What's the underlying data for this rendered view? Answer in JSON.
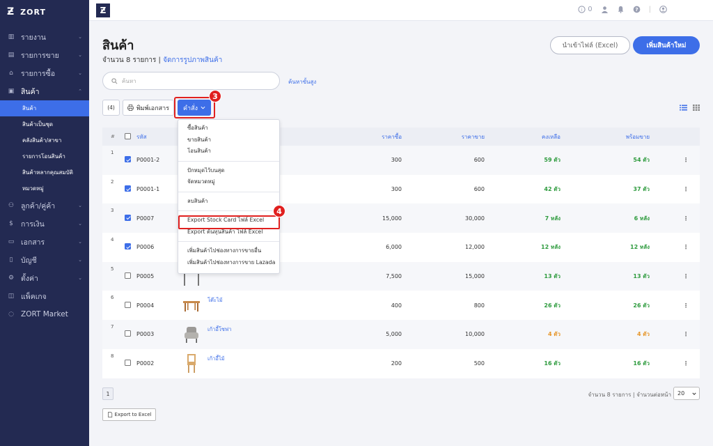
{
  "app": {
    "name": "ZORT",
    "logo_mark": "Ƶ"
  },
  "sidebar": {
    "items": [
      {
        "label": "รายงาน",
        "icon": "chart-icon",
        "has_chevron": true
      },
      {
        "label": "รายการขาย",
        "icon": "receipt-icon",
        "has_chevron": true
      },
      {
        "label": "รายการซื้อ",
        "icon": "basket-icon",
        "has_chevron": true
      },
      {
        "label": "สินค้า",
        "icon": "box-icon",
        "has_chevron": true,
        "open": true
      },
      {
        "label": "ลูกค้า/คู่ค้า",
        "icon": "people-icon",
        "has_chevron": true
      },
      {
        "label": "การเงิน",
        "icon": "money-icon",
        "has_chevron": true
      },
      {
        "label": "เอกสาร",
        "icon": "document-icon",
        "has_chevron": true
      },
      {
        "label": "บัญชี",
        "icon": "ledger-icon",
        "has_chevron": true
      },
      {
        "label": "ตั้งค่า",
        "icon": "gear-icon",
        "has_chevron": true
      },
      {
        "label": "แพ็คเกจ",
        "icon": "package-icon",
        "has_chevron": false
      },
      {
        "label": "ZORT Market",
        "icon": "market-icon",
        "has_chevron": false
      }
    ],
    "sub_items": [
      {
        "label": "สินค้า",
        "active": true
      },
      {
        "label": "สินค้าเป็นชุด"
      },
      {
        "label": "คลังสินค้า/สาขา"
      },
      {
        "label": "รายการโอนสินค้า"
      },
      {
        "label": "สินค้าหลากคุณสมบัติ"
      },
      {
        "label": "หมวดหมู่"
      }
    ]
  },
  "topbar": {
    "logo_mark": "Ƶ",
    "notification_count": "0"
  },
  "header": {
    "title": "สินค้า",
    "count_text": "จำนวน 8 รายการ",
    "separator": " | ",
    "manage_images_link": "จัดการรูปภาพสินค้า",
    "import_button": "นำเข้าไฟล์ (Excel)",
    "add_button": "เพิ่มสินค้าใหม่"
  },
  "search": {
    "placeholder": "ค้นหา",
    "advanced_link": "ค้นหาขั้นสูง"
  },
  "toolbar": {
    "selected_count": "(4)",
    "print_button": "พิมพ์เอกสาร",
    "command_button": "คำสั่ง"
  },
  "annotations": {
    "step3": "3",
    "step4": "4"
  },
  "dropdown": {
    "group1": [
      "ซื้อสินค้า",
      "ขายสินค้า",
      "โอนสินค้า"
    ],
    "group2": [
      "ปักหมุดไว้บนสุด",
      "จัดหมวดหมู่"
    ],
    "group3": [
      "ลบสินค้า"
    ],
    "group4": [
      "Export Stock Card ไฟล์ Excel",
      "Export ต้นทุนสินค้า ไฟล์ Excel"
    ],
    "group5": [
      "เพิ่มสินค้าไปช่องทางการขายอื่น",
      "เพิ่มสินค้าไปช่องทางการขาย Lazada"
    ]
  },
  "table": {
    "headers": {
      "idx": "#",
      "sku": "รหัส",
      "buy": "ราคาซื้อ",
      "sell": "ราคาขาย",
      "remaining": "คงเหลือ",
      "ready": "พร้อมขาย"
    },
    "rows": [
      {
        "idx": "1",
        "checked": true,
        "sku": "P0001-2",
        "name": "",
        "buy": "300",
        "sell": "600",
        "remaining": "59 ตัว",
        "ready": "54 ตัว",
        "color": "green",
        "img": ""
      },
      {
        "idx": "2",
        "checked": true,
        "sku": "P0001-1",
        "name": "",
        "buy": "300",
        "sell": "600",
        "remaining": "42 ตัว",
        "ready": "37 ตัว",
        "color": "green",
        "img": ""
      },
      {
        "idx": "3",
        "checked": true,
        "sku": "P0007",
        "name": "",
        "buy": "15,000",
        "sell": "30,000",
        "remaining": "7 หลัง",
        "ready": "6 หลัง",
        "color": "green",
        "img": ""
      },
      {
        "idx": "4",
        "checked": true,
        "sku": "P0006",
        "name": "",
        "buy": "6,000",
        "sell": "12,000",
        "remaining": "12 หลัง",
        "ready": "12 หลัง",
        "color": "green",
        "img": ""
      },
      {
        "idx": "5",
        "checked": false,
        "sku": "P0005",
        "name": "",
        "buy": "7,500",
        "sell": "15,000",
        "remaining": "13 ตัว",
        "ready": "13 ตัว",
        "color": "green",
        "img": "chair-grey"
      },
      {
        "idx": "6",
        "checked": false,
        "sku": "P0004",
        "name": "โต๊ะไม้",
        "buy": "400",
        "sell": "800",
        "remaining": "26 ตัว",
        "ready": "26 ตัว",
        "color": "green",
        "img": "table"
      },
      {
        "idx": "7",
        "checked": false,
        "sku": "P0003",
        "name": "เก้าอี้โซฟา",
        "buy": "5,000",
        "sell": "10,000",
        "remaining": "4 ตัว",
        "ready": "4 ตัว",
        "color": "orange",
        "img": "armchair"
      },
      {
        "idx": "8",
        "checked": false,
        "sku": "P0002",
        "name": "เก้าอี้ไม้",
        "buy": "200",
        "sell": "500",
        "remaining": "16 ตัว",
        "ready": "16 ตัว",
        "color": "green",
        "img": "wood-chair"
      }
    ]
  },
  "footer": {
    "page": "1",
    "info": "จำนวน 8 รายการ | จำนวนต่อหน้า",
    "per_page": "20",
    "export_button": "Export to Excel"
  },
  "colors": {
    "sidebar_bg": "#232a52",
    "accent": "#3d6ee8",
    "highlight": "#e0201f",
    "stock_green": "#2e9b3e",
    "stock_orange": "#e6962a"
  }
}
